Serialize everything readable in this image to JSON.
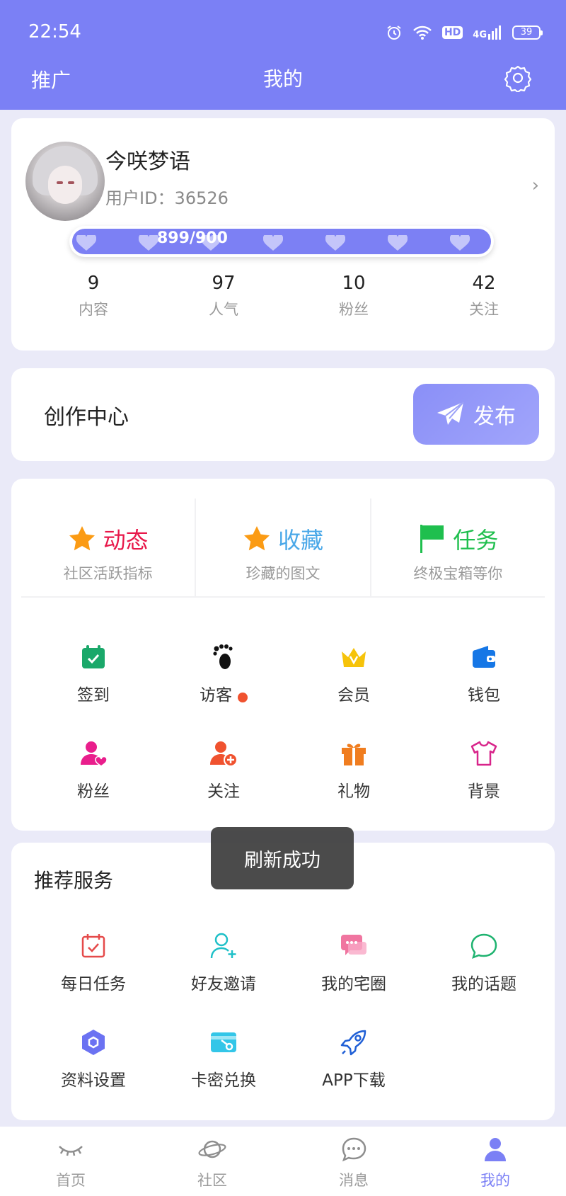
{
  "status_bar": {
    "time": "22:54",
    "hd": "HD",
    "network": "4G",
    "battery": "39"
  },
  "nav": {
    "left": "推广",
    "title": "我的"
  },
  "profile": {
    "name": "今咲梦语",
    "user_id": "用户ID：36526",
    "level_progress": "899/900",
    "level_fraction": 0.999
  },
  "stats": [
    {
      "num": "9",
      "label": "内容"
    },
    {
      "num": "97",
      "label": "人气"
    },
    {
      "num": "10",
      "label": "粉丝"
    },
    {
      "num": "42",
      "label": "关注"
    }
  ],
  "creation": {
    "title": "创作中心",
    "publish": "发布"
  },
  "features": [
    {
      "title": "动态",
      "sub": "社区活跃指标",
      "color": "#e8184a"
    },
    {
      "title": "收藏",
      "sub": "珍藏的图文",
      "color": "#4aa8e8"
    },
    {
      "title": "任务",
      "sub": "终极宝箱等你",
      "color": "#1fbf4e"
    }
  ],
  "grid1": [
    {
      "label": "签到",
      "icon": "calendar-check-icon",
      "color": "#1aa86a"
    },
    {
      "label": "访客",
      "icon": "footprint-icon",
      "color": "#111111",
      "badge": true
    },
    {
      "label": "会员",
      "icon": "crown-icon",
      "color": "#f6c30a"
    },
    {
      "label": "钱包",
      "icon": "wallet-icon",
      "color": "#1677e6"
    }
  ],
  "grid2": [
    {
      "label": "粉丝",
      "icon": "user-heart-icon",
      "color": "#e91e8c"
    },
    {
      "label": "关注",
      "icon": "user-add-icon",
      "color": "#f0522f"
    },
    {
      "label": "礼物",
      "icon": "gift-icon",
      "color": "#f07d1f"
    },
    {
      "label": "背景",
      "icon": "tshirt-icon",
      "color": "#d8248a"
    }
  ],
  "recommend": {
    "title": "推荐服务",
    "row1": [
      {
        "label": "每日任务",
        "icon": "calendar-task-icon",
        "color": "#e54a4a"
      },
      {
        "label": "好友邀请",
        "icon": "user-invite-icon",
        "color": "#1fc0c8"
      },
      {
        "label": "我的宅圈",
        "icon": "chat-bubbles-icon",
        "color": "#f075a0"
      },
      {
        "label": "我的话题",
        "icon": "chat-circle-icon",
        "color": "#1fb370"
      }
    ],
    "row2": [
      {
        "label": "资料设置",
        "icon": "hexagon-settings-icon",
        "color": "#6b72f2"
      },
      {
        "label": "卡密兑换",
        "icon": "card-key-icon",
        "color": "#33c6e8"
      },
      {
        "label": "APP下载",
        "icon": "rocket-icon",
        "color": "#1f5fd6"
      }
    ]
  },
  "toast": "刷新成功",
  "bottom_nav": [
    {
      "label": "首页",
      "icon": "eye-closed-icon"
    },
    {
      "label": "社区",
      "icon": "planet-icon"
    },
    {
      "label": "消息",
      "icon": "chat-icon"
    },
    {
      "label": "我的",
      "icon": "person-icon",
      "active": true
    }
  ]
}
